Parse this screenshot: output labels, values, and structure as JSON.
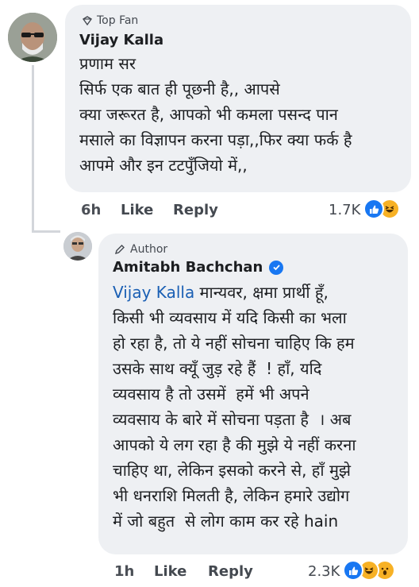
{
  "comment1": {
    "badge": "Top Fan",
    "author": "Vijay Kalla",
    "lines": [
      "प्रणाम सर",
      "सिर्फ एक बात ही पूछनी है,, आपसे",
      "क्या जरूरत है, आपको भी कमला पसन्द पान",
      "मसाले का विज्ञापन करना पड़ा,,फिर क्या फर्क है",
      "आपमे और इन टटपुँजियो में,,"
    ],
    "time": "6h",
    "like_label": "Like",
    "reply_label": "Reply",
    "reaction_count": "1.7K"
  },
  "reply1": {
    "badge": "Author",
    "author": "Amitabh Bachchan",
    "mention": "Vijay Kalla",
    "first_line_rest": " मान्यवर, क्षमा प्रार्थी हूँ,",
    "lines": [
      "किसी भी व्यवसाय में यदि किसी का भला",
      "हो रहा है, तो ये नहीं सोचना चाहिए कि हम",
      "उसके साथ क्यूँ जुड़ रहे हैं  ! हाँ, यदि",
      "व्यवसाय है तो उसमें  हमें भी अपने",
      "व्यवसाय के बारे में सोचना पड़ता है  । अब",
      "आपको ये लग रहा है की मुझे ये नहीं करना",
      "चाहिए था, लेकिन इसको करने से, हाँ मुझे",
      "भी धनराशि मिलती है, लेकिन हमारे उद्योग",
      "में जो बहुत  से लोग काम कर रहे hain"
    ],
    "time": "1h",
    "like_label": "Like",
    "reply_label": "Reply",
    "reaction_count": "2.3K"
  },
  "colors": {
    "bubble": "#eef0f3",
    "like_blue": "#1877f2",
    "haha_yellow": "#f7b125",
    "love_red": "#f33e58"
  }
}
